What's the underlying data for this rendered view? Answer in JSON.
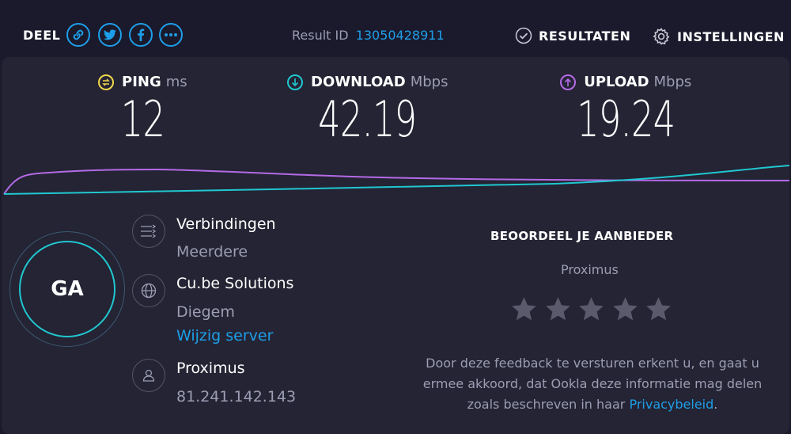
{
  "share": {
    "label": "DEEL",
    "buttons": [
      "link-icon",
      "twitter-icon",
      "facebook-icon",
      "more-icon"
    ]
  },
  "result": {
    "label": "Result ID",
    "id": "13050428911"
  },
  "nav": {
    "results_label": "RESULTATEN",
    "settings_label": "INSTELLINGEN"
  },
  "metrics": {
    "ping": {
      "label": "PING",
      "unit": "ms",
      "value": "12",
      "color": "#f2d74b"
    },
    "download": {
      "label": "DOWNLOAD",
      "unit": "Mbps",
      "value": "42.19",
      "color": "#20c7d0"
    },
    "upload": {
      "label": "UPLOAD",
      "unit": "Mbps",
      "value": "19.24",
      "color": "#b46ae6"
    }
  },
  "go_button": {
    "label": "GA"
  },
  "connection": {
    "title": "Verbindingen",
    "value": "Meerdere"
  },
  "server": {
    "name": "Cu.be Solutions",
    "location": "Diegem",
    "change_label": "Wijzig server"
  },
  "isp": {
    "name": "Proximus",
    "ip": "81.241.142.143"
  },
  "rating": {
    "title": "BEOORDEEL JE AANBIEDER",
    "provider": "Proximus",
    "stars": 5,
    "disclaimer": "Door deze feedback te versturen erkent u, en gaat u ermee akkoord, dat Ookla deze informatie mag delen zoals beschreven in haar",
    "link": "Privacybeleid",
    "suffix": "."
  },
  "colors": {
    "accent": "#1e9ee8",
    "background": "#1a1a2c",
    "panel": "#242434",
    "ring": "#20c7d0"
  }
}
